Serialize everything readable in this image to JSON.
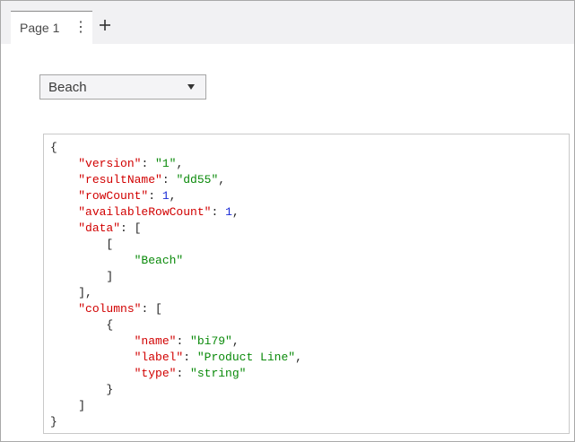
{
  "tabs": [
    {
      "label": "Page 1",
      "menu_icon": "vertical-ellipsis-icon"
    }
  ],
  "add_tab_icon": "plus-icon",
  "dropdown": {
    "selected": "Beach",
    "caret_icon": "caret-down-icon"
  },
  "json_view": {
    "lines": [
      [
        {
          "t": "p",
          "v": "{"
        }
      ],
      [
        {
          "t": "p",
          "v": "    "
        },
        {
          "t": "k",
          "v": "\"version\""
        },
        {
          "t": "p",
          "v": ": "
        },
        {
          "t": "s",
          "v": "\"1\""
        },
        {
          "t": "p",
          "v": ","
        }
      ],
      [
        {
          "t": "p",
          "v": "    "
        },
        {
          "t": "k",
          "v": "\"resultName\""
        },
        {
          "t": "p",
          "v": ": "
        },
        {
          "t": "s",
          "v": "\"dd55\""
        },
        {
          "t": "p",
          "v": ","
        }
      ],
      [
        {
          "t": "p",
          "v": "    "
        },
        {
          "t": "k",
          "v": "\"rowCount\""
        },
        {
          "t": "p",
          "v": ": "
        },
        {
          "t": "n",
          "v": "1"
        },
        {
          "t": "p",
          "v": ","
        }
      ],
      [
        {
          "t": "p",
          "v": "    "
        },
        {
          "t": "k",
          "v": "\"availableRowCount\""
        },
        {
          "t": "p",
          "v": ": "
        },
        {
          "t": "n",
          "v": "1"
        },
        {
          "t": "p",
          "v": ","
        }
      ],
      [
        {
          "t": "p",
          "v": "    "
        },
        {
          "t": "k",
          "v": "\"data\""
        },
        {
          "t": "p",
          "v": ": ["
        }
      ],
      [
        {
          "t": "p",
          "v": "        ["
        }
      ],
      [
        {
          "t": "p",
          "v": "            "
        },
        {
          "t": "s",
          "v": "\"Beach\""
        }
      ],
      [
        {
          "t": "p",
          "v": "        ]"
        }
      ],
      [
        {
          "t": "p",
          "v": "    ],"
        }
      ],
      [
        {
          "t": "p",
          "v": "    "
        },
        {
          "t": "k",
          "v": "\"columns\""
        },
        {
          "t": "p",
          "v": ": ["
        }
      ],
      [
        {
          "t": "p",
          "v": "        {"
        }
      ],
      [
        {
          "t": "p",
          "v": "            "
        },
        {
          "t": "k",
          "v": "\"name\""
        },
        {
          "t": "p",
          "v": ": "
        },
        {
          "t": "s",
          "v": "\"bi79\""
        },
        {
          "t": "p",
          "v": ","
        }
      ],
      [
        {
          "t": "p",
          "v": "            "
        },
        {
          "t": "k",
          "v": "\"label\""
        },
        {
          "t": "p",
          "v": ": "
        },
        {
          "t": "s",
          "v": "\"Product Line\""
        },
        {
          "t": "p",
          "v": ","
        }
      ],
      [
        {
          "t": "p",
          "v": "            "
        },
        {
          "t": "k",
          "v": "\"type\""
        },
        {
          "t": "p",
          "v": ": "
        },
        {
          "t": "s",
          "v": "\"string\""
        }
      ],
      [
        {
          "t": "p",
          "v": "        }"
        }
      ],
      [
        {
          "t": "p",
          "v": "    ]"
        }
      ],
      [
        {
          "t": "p",
          "v": "}"
        }
      ]
    ]
  },
  "colors": {
    "key": "#d10000",
    "string": "#0a8a0a",
    "number": "#1a2bd6",
    "punctuation": "#222222"
  }
}
